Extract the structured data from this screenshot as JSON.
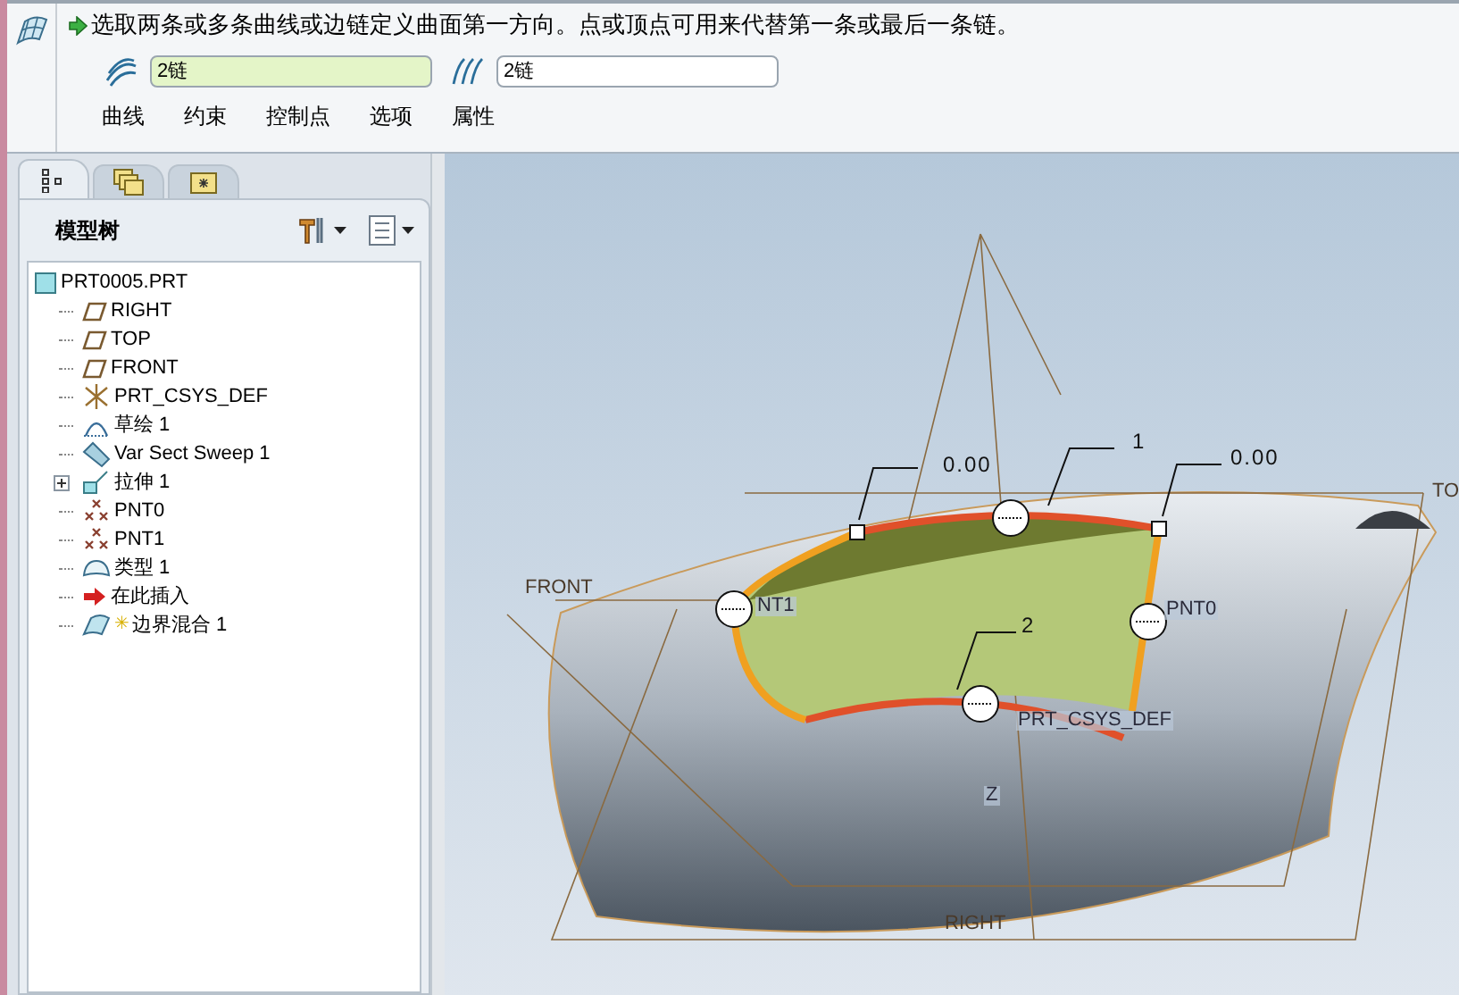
{
  "dashboard": {
    "message": "选取两条或多条曲线或边链定义曲面第一方向。点或顶点可用来代替第一条或最后一条链。",
    "collectors": [
      {
        "value": "2链",
        "selected": true
      },
      {
        "value": "2链",
        "selected": false
      }
    ],
    "tabs": [
      "曲线",
      "约束",
      "控制点",
      "选项",
      "属性"
    ]
  },
  "navigator": {
    "tabs": [
      {
        "kind": "tree",
        "selected": true
      },
      {
        "kind": "folders",
        "selected": false
      },
      {
        "kind": "favorites",
        "selected": false
      }
    ],
    "title": "模型树",
    "tree": {
      "label": "PRT0005.PRT",
      "kind": "part",
      "children": [
        {
          "label": "RIGHT",
          "kind": "plane",
          "expandable": false
        },
        {
          "label": "TOP",
          "kind": "plane",
          "expandable": false
        },
        {
          "label": "FRONT",
          "kind": "plane",
          "expandable": false
        },
        {
          "label": "PRT_CSYS_DEF",
          "kind": "csys",
          "expandable": false
        },
        {
          "label": "草绘 1",
          "kind": "sketch",
          "expandable": false
        },
        {
          "label": "Var Sect Sweep 1",
          "kind": "sweep",
          "expandable": false
        },
        {
          "label": "拉伸 1",
          "kind": "extrude",
          "expandable": true
        },
        {
          "label": "PNT0",
          "kind": "point",
          "expandable": false
        },
        {
          "label": "PNT1",
          "kind": "point",
          "expandable": false
        },
        {
          "label": "类型 1",
          "kind": "surface",
          "expandable": false
        },
        {
          "label": "在此插入",
          "kind": "insert",
          "expandable": false
        },
        {
          "label": "边界混合 1",
          "kind": "blend",
          "expandable": false,
          "marker": "✳"
        }
      ]
    }
  },
  "viewport": {
    "labels": [
      {
        "text": "0.00",
        "kind": "dimension"
      },
      {
        "text": "1",
        "kind": "dimension"
      },
      {
        "text": "0.00",
        "kind": "dimension"
      },
      {
        "text": "TO",
        "kind": "datum"
      },
      {
        "text": "FRONT",
        "kind": "datum"
      },
      {
        "text": "NT1",
        "kind": "point"
      },
      {
        "text": "PNT0",
        "kind": "point"
      },
      {
        "text": "2",
        "kind": "dimension"
      },
      {
        "text": "PRT_CSYS_DEF",
        "kind": "point"
      },
      {
        "text": "Z",
        "kind": "point"
      },
      {
        "text": "RIGHT",
        "kind": "datum"
      }
    ]
  }
}
